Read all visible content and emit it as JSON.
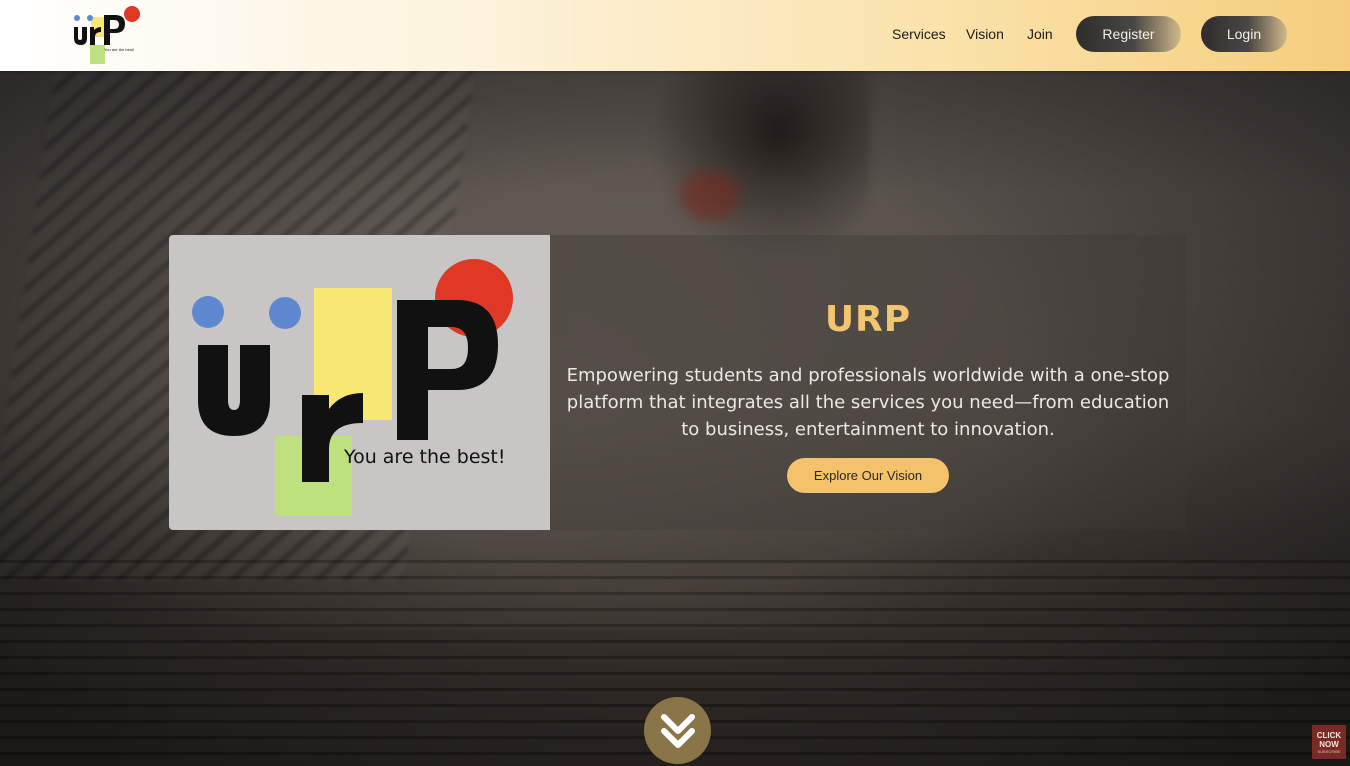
{
  "header": {
    "logo": {
      "letters": "urP",
      "tagline": "You are the best!"
    },
    "nav": [
      "Services",
      "Vision",
      "Join"
    ],
    "register_label": "Register",
    "login_label": "Login"
  },
  "hero": {
    "logo": {
      "letters": "urP",
      "tagline": "You are the best!"
    },
    "title": "URP",
    "description": "Empowering students and professionals worldwide with a one-stop platform that integrates all the services you need—from education to business, entertainment to innovation.",
    "cta_label": "Explore Our Vision"
  },
  "scroll_icon": "double-chevron-down-icon",
  "corner_badge": {
    "line1": "CLICK",
    "line2": "NOW",
    "line3": "SUBSCRIBE"
  },
  "colors": {
    "accent": "#f3c26b",
    "title": "#f2c570",
    "logo_blue": "#5f87cf",
    "logo_yellow": "#f8e873",
    "logo_green": "#bfe07f",
    "logo_red": "#df3825"
  }
}
